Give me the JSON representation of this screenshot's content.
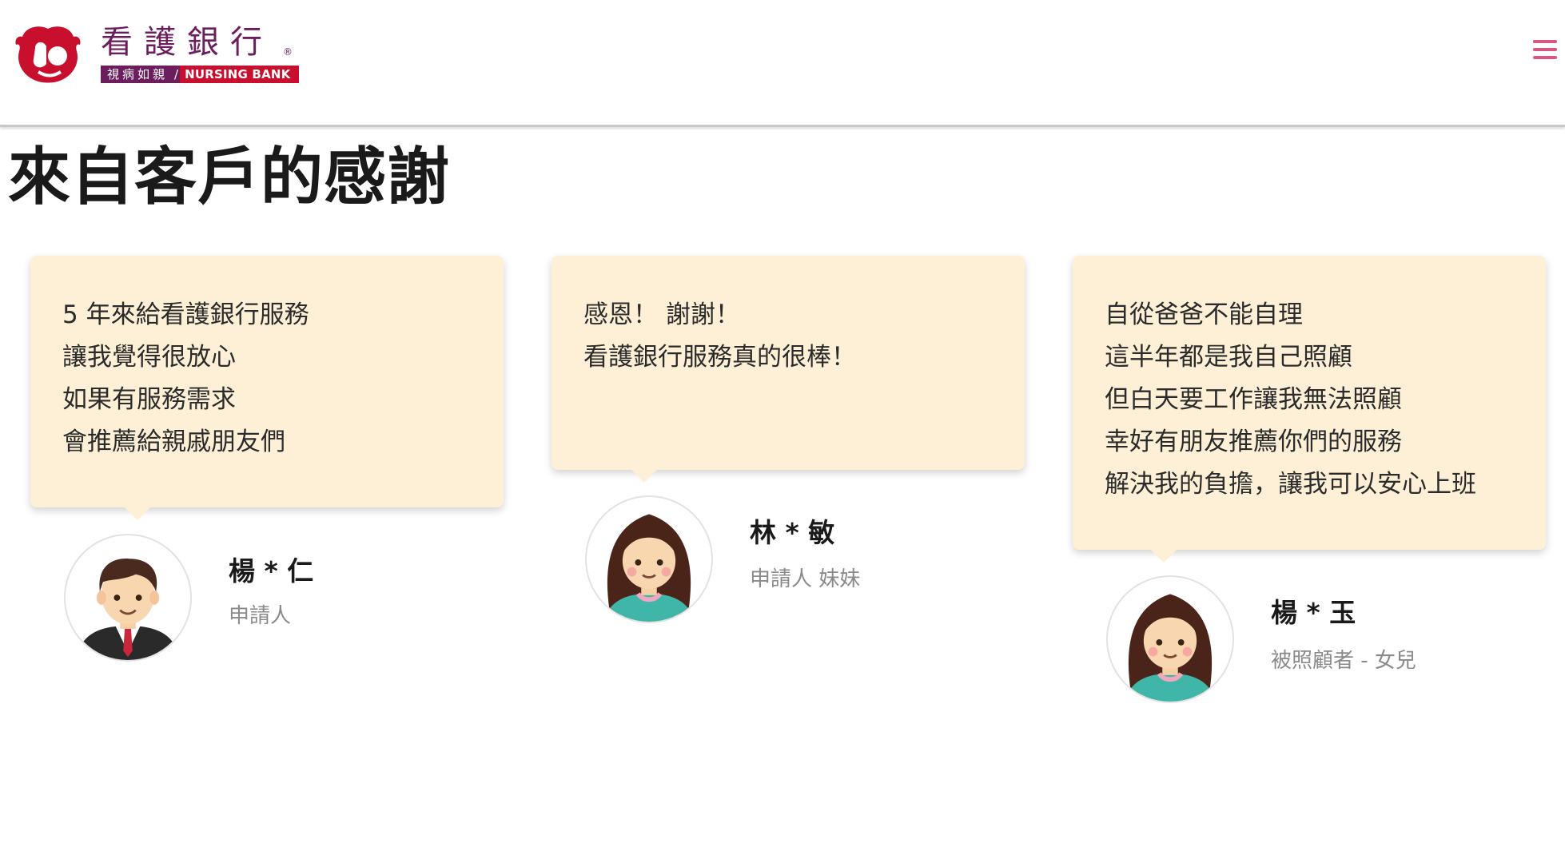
{
  "header": {
    "logo": {
      "name": "看護銀行",
      "registered": "®",
      "tagline_zh": "視病如親",
      "tagline_separator": "/",
      "tagline_en": "NURSING BANK"
    },
    "menu_icon": "hamburger-menu-icon"
  },
  "page": {
    "title": "來自客戶的感謝"
  },
  "colors": {
    "brand_purple": "#6b1d5e",
    "brand_red": "#c8102e",
    "menu_pink": "#d6577f",
    "card_background": "#fdf0d6"
  },
  "testimonials": [
    {
      "lines": [
        "5 年來給看護銀行服務",
        "讓我覺得很放心",
        "如果有服務需求",
        "會推薦給親戚朋友們"
      ],
      "name": "楊 * 仁",
      "role": "申請人",
      "avatar": "male-avatar-icon"
    },
    {
      "lines": [
        "感恩！ 謝謝！",
        "看護銀行服務真的很棒！"
      ],
      "name": "林 * 敏",
      "role": "申請人 妹妹",
      "avatar": "female-avatar-icon"
    },
    {
      "lines": [
        "自從爸爸不能自理",
        "這半年都是我自己照顧",
        "但白天要工作讓我無法照顧",
        "幸好有朋友推薦你們的服務",
        "解決我的負擔，讓我可以安心上班"
      ],
      "name": "楊 * 玉",
      "role": "被照顧者 - 女兒",
      "avatar": "female-avatar-icon"
    }
  ]
}
